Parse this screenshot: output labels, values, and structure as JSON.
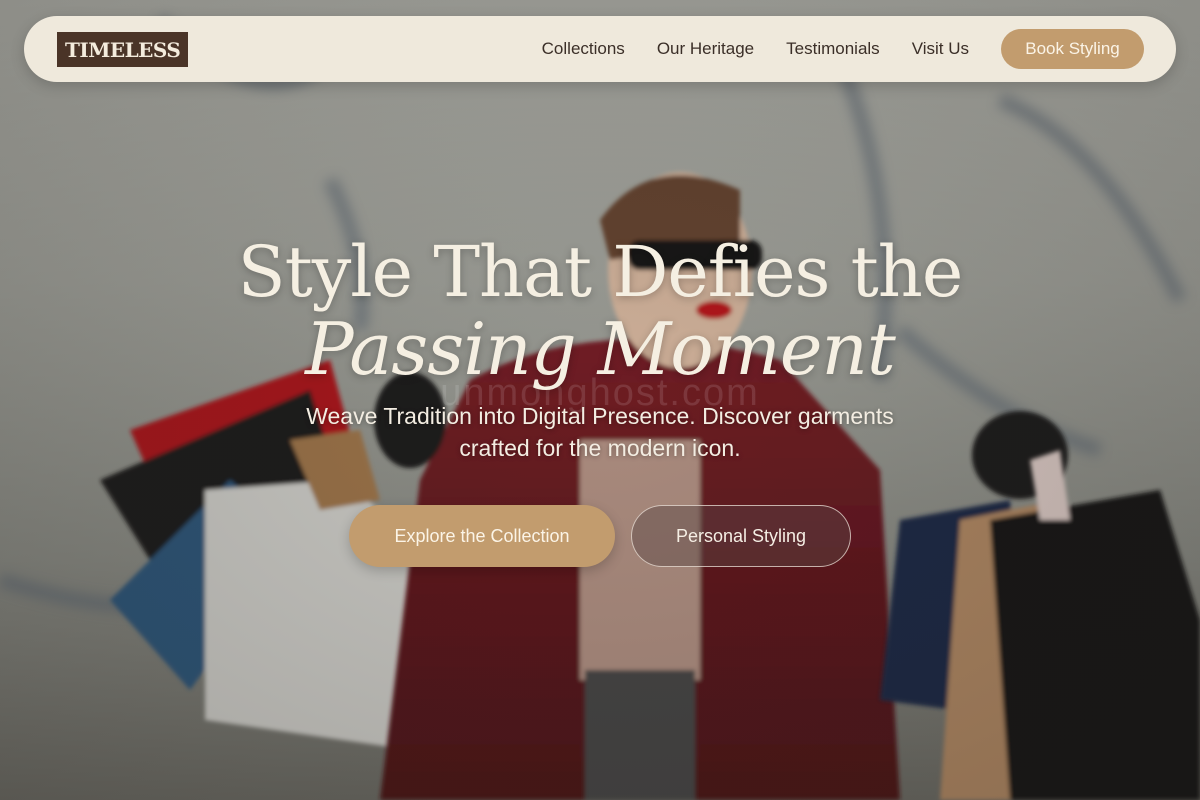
{
  "brand": {
    "logo_text": "TIMELESS"
  },
  "nav": {
    "links": [
      {
        "label": "Collections"
      },
      {
        "label": "Our Heritage"
      },
      {
        "label": "Testimonials"
      },
      {
        "label": "Visit Us"
      }
    ],
    "cta_label": "Book Styling"
  },
  "hero": {
    "title_line1": "Style That Defies the",
    "title_line2": "Passing Moment",
    "subtitle": "Weave Tradition into Digital Presence. Discover garments crafted for the modern icon.",
    "primary_cta": "Explore the Collection",
    "secondary_cta": "Personal Styling",
    "watermark": "unmonghost.com"
  },
  "colors": {
    "nav_bg": "#efe9dc",
    "logo_bg": "#4a3427",
    "accent": "#c29c6e",
    "hero_text": "#f5efe2"
  }
}
